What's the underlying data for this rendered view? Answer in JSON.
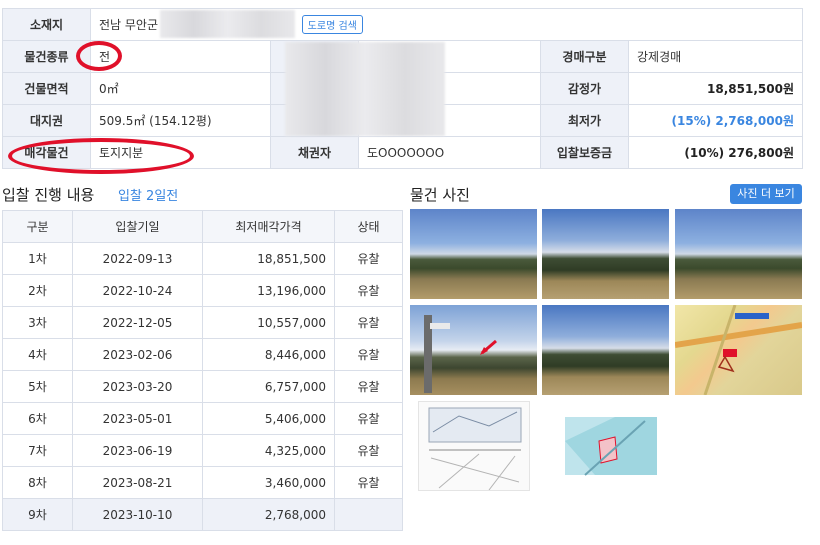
{
  "info": {
    "location_label": "소재지",
    "location_value": "전남 무안군",
    "road_search_label": "도로명 검색",
    "type_label": "물건종류",
    "type_value": "전",
    "auction_type_label": "경매구분",
    "auction_type_value": "강제경매",
    "building_area_label": "건물면적",
    "building_area_value": "0㎡",
    "appraisal_label": "감정가",
    "appraisal_value": "18,851,500원",
    "land_right_label": "대지권",
    "land_right_value": "509.5㎡ (154.12평)",
    "min_price_label": "최저가",
    "min_price_value": "(15%) 2,768,000원",
    "sale_object_label": "매각물건",
    "sale_object_value": "토지지분",
    "creditor_label": "채권자",
    "creditor_value": "도OOOOOOO",
    "deposit_label": "입찰보증금",
    "deposit_value": "(10%) 276,800원"
  },
  "bidding": {
    "title": "입찰 진행 내용",
    "subtitle": "입찰 2일전",
    "columns": [
      "구분",
      "입찰기일",
      "최저매각가격",
      "상태"
    ],
    "rows": [
      {
        "round": "1차",
        "date": "2022-09-13",
        "price": "18,851,500",
        "status": "유찰"
      },
      {
        "round": "2차",
        "date": "2022-10-24",
        "price": "13,196,000",
        "status": "유찰"
      },
      {
        "round": "3차",
        "date": "2022-12-05",
        "price": "10,557,000",
        "status": "유찰"
      },
      {
        "round": "4차",
        "date": "2023-02-06",
        "price": "8,446,000",
        "status": "유찰"
      },
      {
        "round": "5차",
        "date": "2023-03-20",
        "price": "6,757,000",
        "status": "유찰"
      },
      {
        "round": "6차",
        "date": "2023-05-01",
        "price": "5,406,000",
        "status": "유찰"
      },
      {
        "round": "7차",
        "date": "2023-06-19",
        "price": "4,325,000",
        "status": "유찰"
      },
      {
        "round": "8차",
        "date": "2023-08-21",
        "price": "3,460,000",
        "status": "유찰"
      },
      {
        "round": "9차",
        "date": "2023-10-10",
        "price": "2,768,000",
        "status": ""
      }
    ]
  },
  "photos": {
    "title": "물건 사진",
    "more_label": "사진 더 보기"
  },
  "colors": {
    "accent": "#3a86e0",
    "label_bg": "#eef1f8",
    "annotation_red": "#e0102a"
  }
}
